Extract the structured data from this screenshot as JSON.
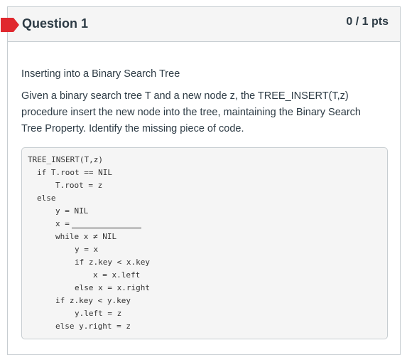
{
  "question": {
    "title": "Question 1",
    "points": "0 / 1 pts",
    "subtitle": "Inserting into a Binary Search Tree",
    "text": "Given a binary search tree T and a new node z, the TREE_INSERT(T,z) procedure insert the new node into the tree, maintaining the Binary Search Tree Property. Identify the missing piece of code.",
    "flag_color": "#e0282e"
  },
  "code": {
    "lines": [
      "TREE_INSERT(T,z)",
      "if T.root == NIL",
      "T.root = z",
      "else",
      "y = NIL",
      "x =",
      "while x ≠ NIL",
      "y = x",
      "if z.key < x.key",
      "x = x.left",
      "else x = x.right",
      "if z.key < y.key",
      "y.left = z",
      "else y.right = z"
    ]
  }
}
